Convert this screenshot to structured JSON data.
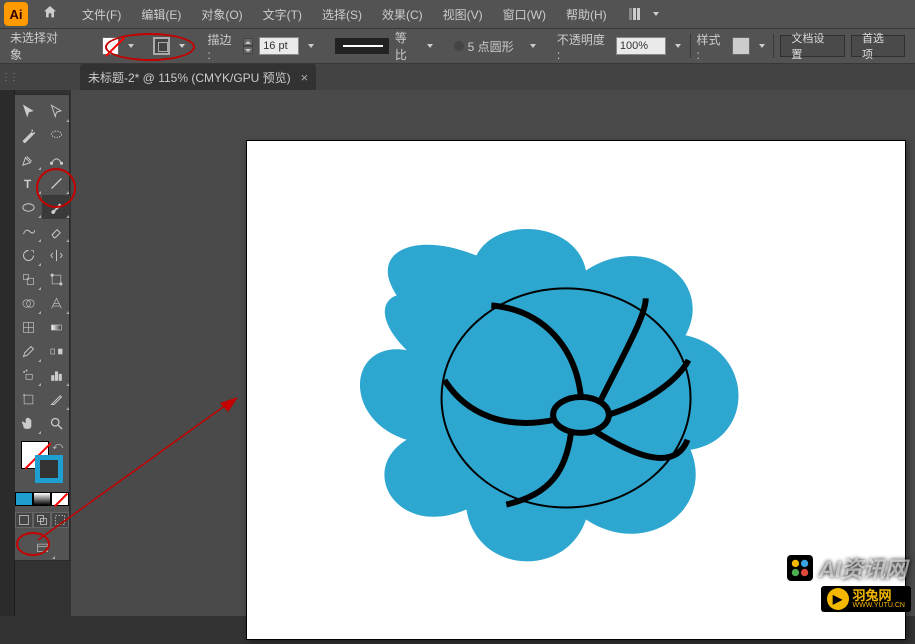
{
  "app": {
    "short": "Ai"
  },
  "menu": {
    "file": "文件(F)",
    "edit": "编辑(E)",
    "object": "对象(O)",
    "type": "文字(T)",
    "select": "选择(S)",
    "effect": "效果(C)",
    "view": "视图(V)",
    "window": "窗口(W)",
    "help": "帮助(H)"
  },
  "control": {
    "no_selection": "未选择对象",
    "stroke_label": "描边 :",
    "stroke_pt": "16 pt",
    "scale_label": "等比",
    "brush_label": "5 点圆形",
    "opacity_label": "不透明度 :",
    "opacity_value": "100%",
    "style_label": "样式 :",
    "doc_setup": "文档设置",
    "preferences": "首选项"
  },
  "tab": {
    "title": "未标题-2* @ 115% (CMYK/GPU 预览)",
    "close": "×"
  },
  "watermark": {
    "badge1": "✱",
    "text1": "AI资讯网",
    "brand2": "羽兔网",
    "url2": "WWW.YUTU.CN"
  },
  "colors": {
    "accent": "#2DA6D0",
    "artwork_stroke": "#000000"
  },
  "chart_data": null
}
